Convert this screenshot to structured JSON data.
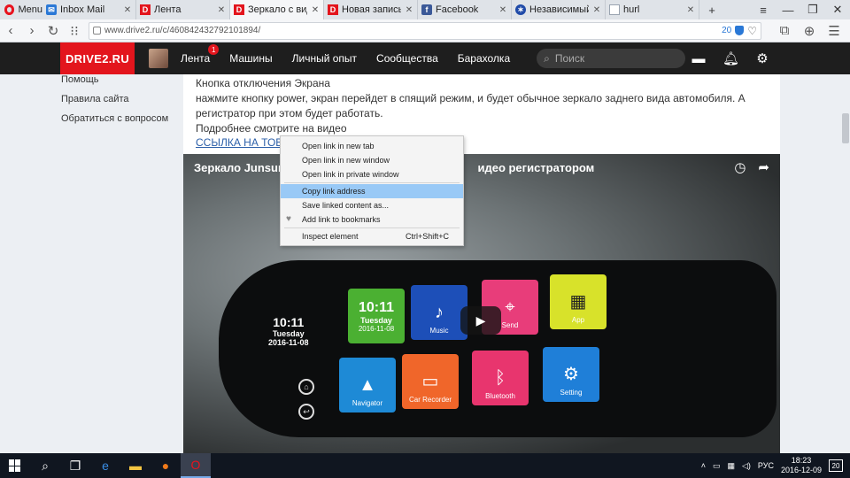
{
  "browser": {
    "menu_label": "Menu",
    "tabs": [
      {
        "title": "Inbox Mail",
        "icon": "mail-icon"
      },
      {
        "title": "Лента",
        "icon": "drive2-icon"
      },
      {
        "title": "Зеркало с видео р",
        "icon": "drive2-icon"
      },
      {
        "title": "Новая запись",
        "icon": "drive2-icon"
      },
      {
        "title": "Facebook",
        "icon": "facebook-icon"
      },
      {
        "title": "Независимый фор",
        "icon": "forum-icon"
      },
      {
        "title": "hurl",
        "icon": "doc-icon"
      }
    ],
    "new_tab_glyph": "+",
    "url": "www.drive2.ru/c/460842432792101894/",
    "adblock_count": "20"
  },
  "site": {
    "logo": "DRIVE2.RU",
    "nav": [
      {
        "label": "Лента",
        "badge": "1"
      },
      {
        "label": "Машины"
      },
      {
        "label": "Личный опыт"
      },
      {
        "label": "Сообщества"
      },
      {
        "label": "Барахолка"
      }
    ],
    "search_placeholder": "Поиск"
  },
  "sidebar": {
    "links": [
      "Помощь",
      "Правила сайта",
      "Обратиться с вопросом"
    ]
  },
  "article": {
    "clipped_line": "Кнопка отключения Экрана",
    "para1": "нажмите кнопку power, экран перейдет в спящий режим, и будет обычное зеркало заднего вида автомобиля. А регистратор при этом будет работать.",
    "para2": "Подробнее смотрите на видео",
    "link": "ССЫЛКА НА ТОВАР"
  },
  "video": {
    "title": "Зеркало Junsun T",
    "title_end": "идео регистратором",
    "time": "10:11",
    "day": "Tuesday",
    "date": "2016-11-08",
    "apps": [
      {
        "label": "",
        "time": "10:11",
        "day": "Tuesday",
        "date": "2016-11-08",
        "color": "#4bb032"
      },
      {
        "label": "Music",
        "color": "#1d4fb8"
      },
      {
        "label": "Send",
        "color": "#e83d7a"
      },
      {
        "label": "App",
        "color": "#d8e22a"
      },
      {
        "label": "Navigator",
        "color": "#1e8ad6"
      },
      {
        "label": "Car Recorder",
        "color": "#f0662a"
      },
      {
        "label": "Bluetooth",
        "color": "#e8356e"
      },
      {
        "label": "Setting",
        "color": "#1f7fd8"
      }
    ]
  },
  "context_menu": {
    "items": [
      {
        "label": "Open link in new tab"
      },
      {
        "label": "Open link in new window"
      },
      {
        "label": "Open link in private window"
      },
      {
        "label": "Copy link address",
        "highlighted": true
      },
      {
        "label": "Save linked content as..."
      },
      {
        "label": "Add link to bookmarks"
      },
      {
        "label": "Inspect element",
        "shortcut": "Ctrl+Shift+C"
      }
    ]
  },
  "taskbar": {
    "lang": "РУС",
    "time": "18:23",
    "date": "2016-12-09",
    "notif_count": "20"
  }
}
